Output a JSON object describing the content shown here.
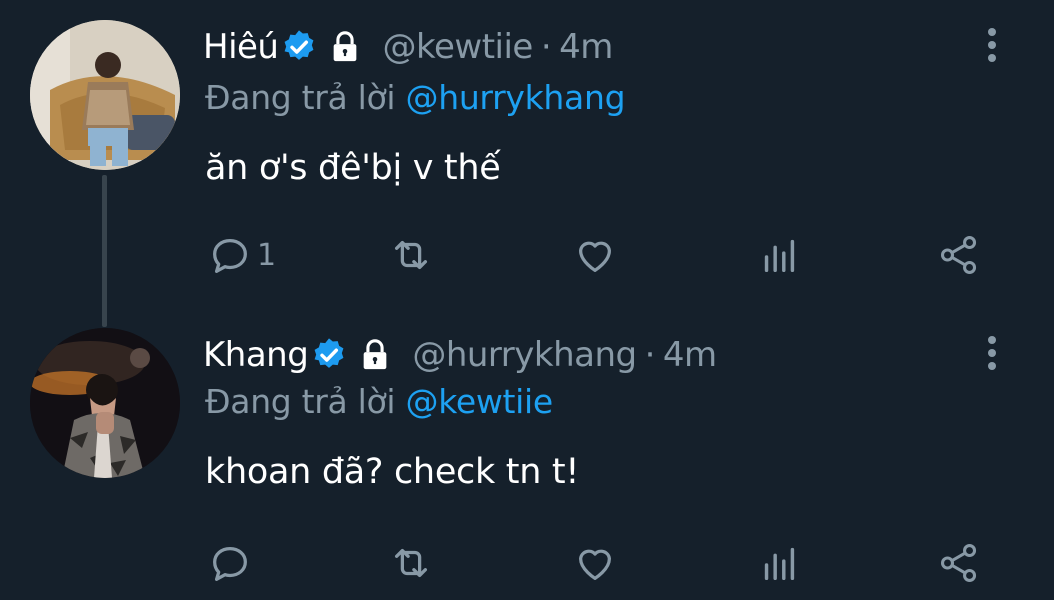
{
  "tweets": [
    {
      "name": "Hiêú",
      "handle": "@kewtiie",
      "dot": "·",
      "time": "4m",
      "reply_prefix": "Đang trả lời",
      "reply_to": "@hurrykhang",
      "text": "ăn ơ's đê'bị v thế",
      "reply_count": "1"
    },
    {
      "name": "Khang",
      "handle": "@hurrykhang",
      "dot": "·",
      "time": "4m",
      "reply_prefix": "Đang trả lời",
      "reply_to": "@kewtiie",
      "text": "khoan đã? check tn t!",
      "reply_count": ""
    }
  ],
  "colors": {
    "background": "#15202b",
    "muted": "#8899a6",
    "accent": "#1da1f2",
    "thread_line": "#38444d"
  },
  "icons": [
    "verified-badge-icon",
    "lock-icon",
    "more-vertical-icon",
    "reply-icon",
    "retweet-icon",
    "like-icon",
    "stats-icon",
    "share-icon"
  ]
}
